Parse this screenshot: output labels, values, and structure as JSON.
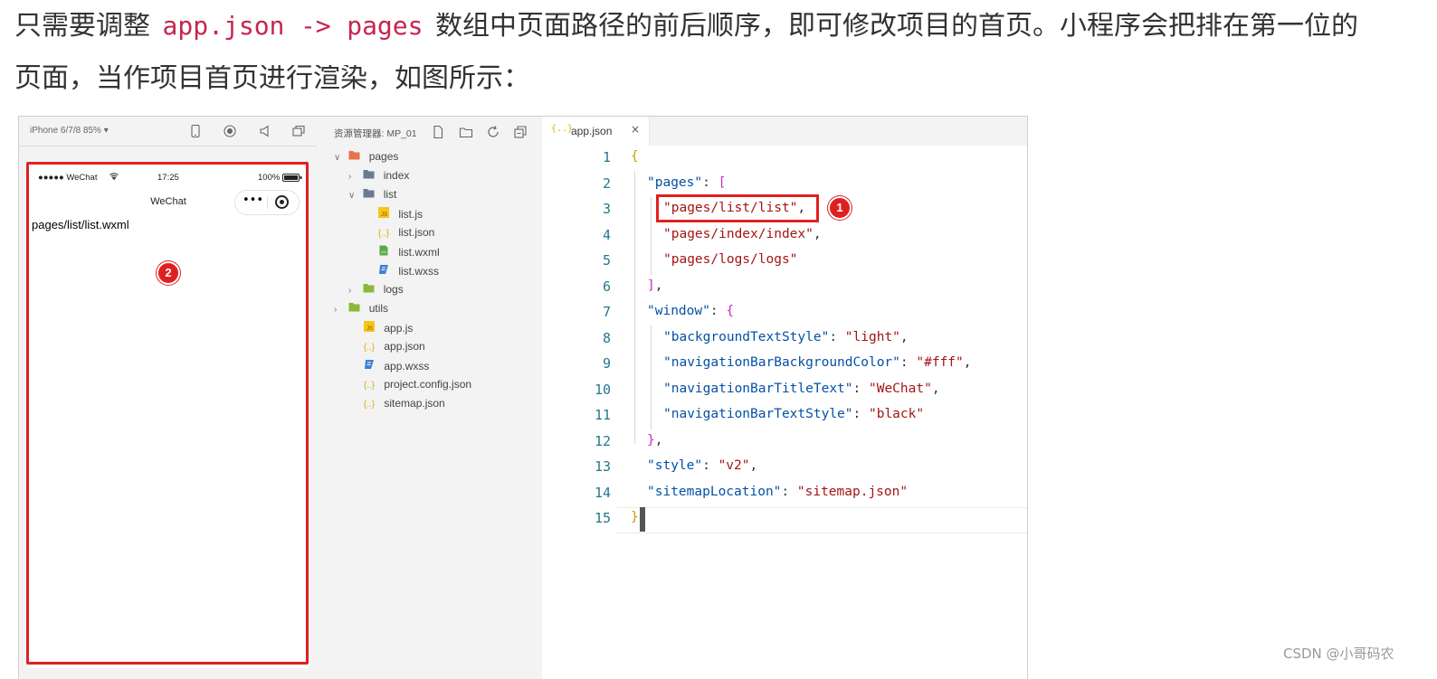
{
  "article": {
    "line1_before": "只需要调整",
    "line1_code_a": "app.json",
    "line1_arrow": "->",
    "line1_code_b": "pages",
    "line1_after": "数组中页面路径的前后顺序，即可修改项目的首页。小程序会把排在第一位的",
    "line2": "页面，当作项目首页进行渲染，如图所示："
  },
  "simulator": {
    "device_label": "iPhone 6/7/8 85% ▾",
    "status_carrier": "●●●●● WeChat",
    "status_time": "17:25",
    "status_battery": "100%",
    "nav_title": "WeChat",
    "capsule_dots": "•••",
    "page_text": "pages/list/list.wxml",
    "annotation_badge": "2"
  },
  "explorer": {
    "title": "资源管理器: MP_01",
    "tree": [
      {
        "label": "pages",
        "type": "folder-open",
        "chevron": "∨",
        "icon_color": "#e8734a"
      },
      {
        "label": "index",
        "type": "folder",
        "chevron": "›",
        "icon_color": "#6b7a8f"
      },
      {
        "label": "list",
        "type": "folder-open",
        "chevron": "∨",
        "icon_color": "#6b7a8f"
      },
      {
        "label": "list.js",
        "type": "js",
        "icon_color": "#f5c518"
      },
      {
        "label": "list.json",
        "type": "json",
        "icon_color": "#d8b300"
      },
      {
        "label": "list.wxml",
        "type": "wxml",
        "icon_color": "#5aa84a"
      },
      {
        "label": "list.wxss",
        "type": "wxss",
        "icon_color": "#3b82d6"
      },
      {
        "label": "logs",
        "type": "folder",
        "chevron": "›",
        "icon_color": "#8bb83a"
      },
      {
        "label": "utils",
        "type": "folder",
        "chevron": "›",
        "icon_color": "#8bb83a"
      },
      {
        "label": "app.js",
        "type": "js",
        "icon_color": "#f5c518"
      },
      {
        "label": "app.json",
        "type": "json",
        "icon_color": "#d8b300"
      },
      {
        "label": "app.wxss",
        "type": "wxss",
        "icon_color": "#3b82d6"
      },
      {
        "label": "project.config.json",
        "type": "json",
        "icon_color": "#d8b300"
      },
      {
        "label": "sitemap.json",
        "type": "json",
        "icon_color": "#d8b300"
      }
    ]
  },
  "editor": {
    "tab_label": "app.json",
    "tab_icon": "{..}",
    "tab_close": "×",
    "line_numbers": [
      "1",
      "2",
      "3",
      "4",
      "5",
      "6",
      "7",
      "8",
      "9",
      "10",
      "11",
      "12",
      "13",
      "14",
      "15"
    ],
    "code": {
      "l1": "{",
      "l2_key": "\"pages\"",
      "l2_rest": ": ",
      "l2_br": "[",
      "l3": "\"pages/list/list\"",
      "l3_comma": ",",
      "l4": "\"pages/index/index\"",
      "l4_comma": ",",
      "l5": "\"pages/logs/logs\"",
      "l6_br": "]",
      "l6_comma": ",",
      "l7_key": "\"window\"",
      "l7_rest": ": ",
      "l7_br": "{",
      "l8_key": "\"backgroundTextStyle\"",
      "l8_val": "\"light\"",
      "l9_key": "\"navigationBarBackgroundColor\"",
      "l9_val": "\"#fff\"",
      "l10_key": "\"navigationBarTitleText\"",
      "l10_val": "\"WeChat\"",
      "l11_key": "\"navigationBarTextStyle\"",
      "l11_val": "\"black\"",
      "l12_br": "}",
      "l12_comma": ",",
      "l13_key": "\"style\"",
      "l13_val": "\"v2\"",
      "l14_key": "\"sitemapLocation\"",
      "l14_val": "\"sitemap.json\"",
      "l15": "}"
    },
    "annotation_badge": "1"
  },
  "watermark": "CSDN @小哥码农",
  "colors": {
    "annotation_red": "#e02020",
    "json_key": "#0451a5",
    "json_string": "#a31515"
  }
}
